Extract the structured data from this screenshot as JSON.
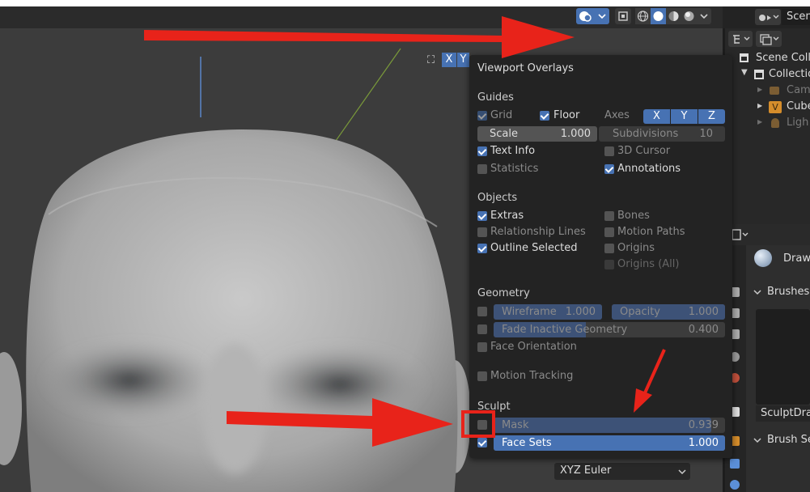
{
  "header": {
    "axis_x": "X",
    "axis_y": "Y",
    "scene_label": "Scen"
  },
  "outliner": {
    "root": "Scene Coll",
    "items": [
      "Collectio",
      "Cam",
      "Cube",
      "Ligh"
    ]
  },
  "properties": {
    "brush_name_label": "Draw",
    "brushes_panel": "Brushes",
    "brush_preview_name": "SculptDra",
    "brush_settings_panel": "Brush Se",
    "rotation_mode": "XYZ Euler"
  },
  "overlays": {
    "title": "Viewport Overlays",
    "guides": {
      "heading": "Guides",
      "grid": "Grid",
      "floor": "Floor",
      "axes": "Axes",
      "axis_x": "X",
      "axis_y": "Y",
      "axis_z": "Z",
      "scale_label": "Scale",
      "scale_value": "1.000",
      "subdivisions_label": "Subdivisions",
      "subdivisions_value": "10",
      "text_info": "Text Info",
      "cursor_3d": "3D Cursor",
      "statistics": "Statistics",
      "annotations": "Annotations"
    },
    "objects": {
      "heading": "Objects",
      "extras": "Extras",
      "bones": "Bones",
      "relationship_lines": "Relationship Lines",
      "motion_paths": "Motion Paths",
      "outline_selected": "Outline Selected",
      "origins": "Origins",
      "origins_all": "Origins (All)"
    },
    "geometry": {
      "heading": "Geometry",
      "wireframe_label": "Wireframe",
      "wireframe_value": "1.000",
      "opacity_label": "Opacity",
      "opacity_value": "1.000",
      "fade_label": "Fade Inactive Geometry",
      "fade_value": "0.400",
      "face_orientation": "Face Orientation",
      "motion_tracking": "Motion Tracking"
    },
    "sculpt": {
      "heading": "Sculpt",
      "mask_label": "Mask",
      "mask_value": "0.939",
      "mask_fraction": 0.939,
      "face_sets_label": "Face Sets",
      "face_sets_value": "1.000",
      "face_sets_fraction": 1.0
    }
  },
  "colors": {
    "accent": "#4772b3",
    "annotation_red": "#e8231a"
  }
}
